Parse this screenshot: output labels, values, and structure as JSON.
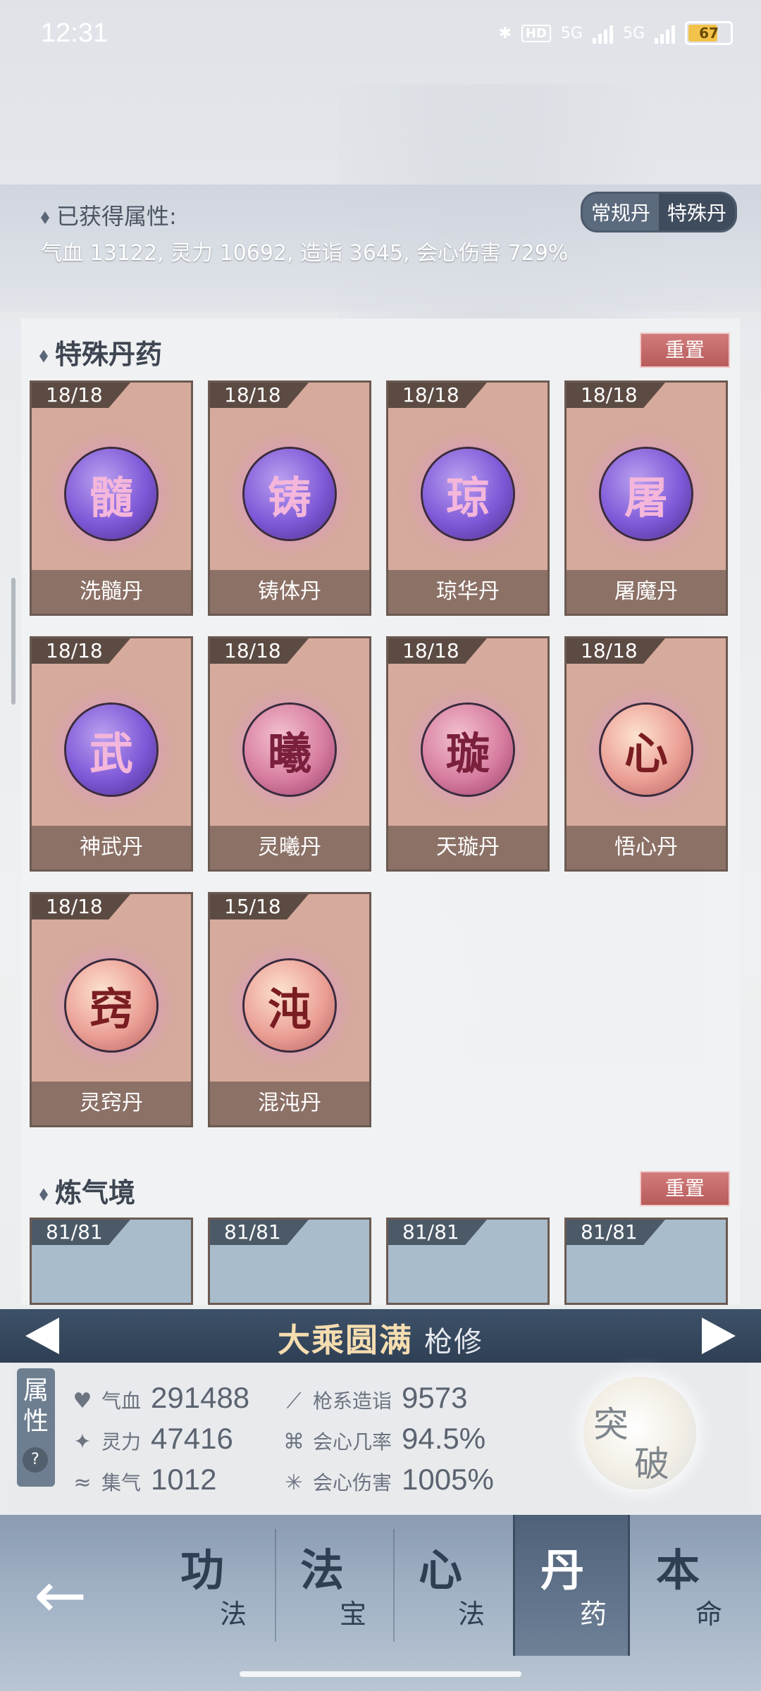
{
  "status_bar": {
    "time": "12:31",
    "network": "5G",
    "network2": "5G",
    "hd": "HD",
    "battery": "67"
  },
  "obtained": {
    "title": "已获得属性:",
    "values": "气血 13122, 灵力 10692, 造诣 3645, 会心伤害 729%",
    "toggle": [
      "常规丹",
      "特殊丹"
    ]
  },
  "special_section": {
    "title": "特殊丹药",
    "reset": "重置",
    "cards": [
      {
        "count": "18/18",
        "glyph": "髓",
        "name": "洗髓丹"
      },
      {
        "count": "18/18",
        "glyph": "铸",
        "name": "铸体丹"
      },
      {
        "count": "18/18",
        "glyph": "琼",
        "name": "琼华丹"
      },
      {
        "count": "18/18",
        "glyph": "屠",
        "name": "屠魔丹"
      },
      {
        "count": "18/18",
        "glyph": "武",
        "name": "神武丹"
      },
      {
        "count": "18/18",
        "glyph": "曦",
        "name": "灵曦丹"
      },
      {
        "count": "18/18",
        "glyph": "璇",
        "name": "天璇丹"
      },
      {
        "count": "18/18",
        "glyph": "心",
        "name": "悟心丹"
      },
      {
        "count": "18/18",
        "glyph": "窍",
        "name": "灵窍丹"
      },
      {
        "count": "15/18",
        "glyph": "沌",
        "name": "混沌丹"
      }
    ]
  },
  "qi_section": {
    "title": "炼气境",
    "reset": "重置",
    "cards": [
      {
        "count": "81/81"
      },
      {
        "count": "81/81"
      },
      {
        "count": "81/81"
      },
      {
        "count": "81/81"
      }
    ]
  },
  "realm": {
    "title": "大乘圆满",
    "sub": "枪修"
  },
  "stats": {
    "tag_top": "属",
    "tag_bottom": "性",
    "help": "?",
    "items": [
      {
        "label": "气血",
        "value": "291488"
      },
      {
        "label": "灵力",
        "value": "47416"
      },
      {
        "label": "集气",
        "value": "1012"
      },
      {
        "label": "枪系造诣",
        "value": "9573"
      },
      {
        "label": "会心几率",
        "value": "94.5%"
      },
      {
        "label": "会心伤害",
        "value": "1005%"
      }
    ],
    "breakthrough": [
      "突",
      "破"
    ]
  },
  "nav": {
    "back": "←",
    "tabs": [
      {
        "main": "功",
        "sub": "法"
      },
      {
        "main": "法",
        "sub": "宝"
      },
      {
        "main": "心",
        "sub": "法"
      },
      {
        "main": "丹",
        "sub": "药"
      },
      {
        "main": "本",
        "sub": "命"
      }
    ]
  }
}
